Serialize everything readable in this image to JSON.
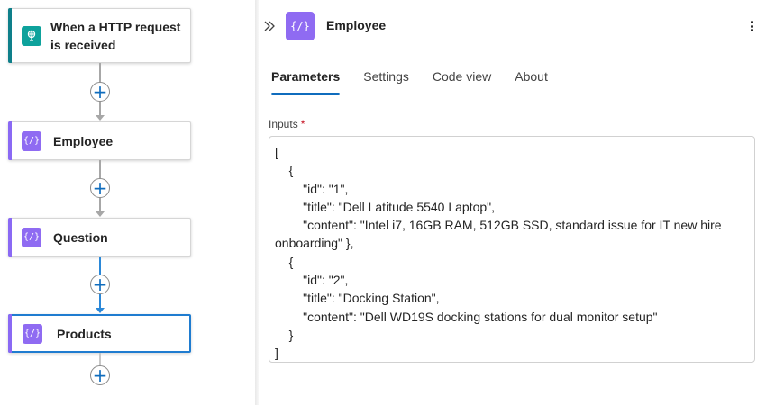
{
  "canvas": {
    "trigger": {
      "title_line1": "When a HTTP request",
      "title_line2": "is received",
      "icon": "http-request-icon"
    },
    "actions": [
      {
        "title": "Employee",
        "icon": "compose-icon"
      },
      {
        "title": "Question",
        "icon": "compose-icon"
      },
      {
        "title": "Products",
        "icon": "compose-icon"
      }
    ],
    "add_symbol": "+",
    "colors": {
      "trigger_accent": "#0e7f8a",
      "compose_accent": "#8a69f4",
      "selected_border": "#1f7cd0",
      "connector_active": "#2b88d8"
    }
  },
  "panel": {
    "title": "Employee",
    "icon": "compose-icon",
    "tabs": [
      "Parameters",
      "Settings",
      "Code view",
      "About"
    ],
    "active_tab": "Parameters",
    "inputs_label": "Inputs",
    "required_marker": "*",
    "inputs_value": [
      "[",
      "    {",
      "        \"id\": \"1\",",
      "        \"title\": \"Dell Latitude 5540 Laptop\",",
      "        \"content\": \"Intel i7, 16GB RAM, 512GB SSD, standard issue for IT new hire onboarding\" },",
      "    {",
      "        \"id\": \"2\",",
      "        \"title\": \"Docking Station\",",
      "        \"content\": \"Dell WD19S docking stations for dual monitor setup\"",
      "    }",
      "]"
    ]
  }
}
